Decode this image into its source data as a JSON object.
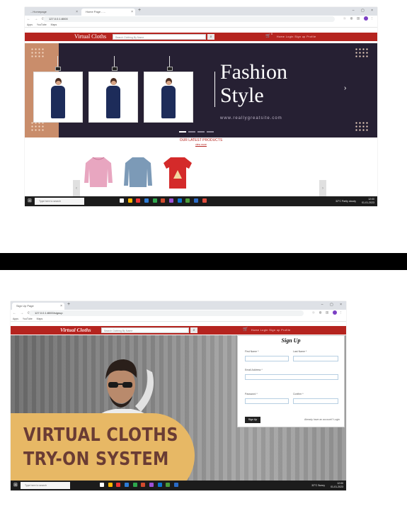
{
  "screenshot1": {
    "tabs": [
      {
        "label": "...Homepage",
        "active": false
      },
      {
        "label": "Home Page - ...",
        "active": true
      }
    ],
    "url": "127.0.0.1:8000",
    "bookmarks": [
      "Apps",
      "YouTube",
      "Maps"
    ],
    "site": {
      "brand": "Virtual Cloths",
      "search_placeholder": "Search Clothing By Name",
      "cart_count": "0",
      "nav_links": "Home  Login  Sign up  Profile"
    },
    "hero": {
      "title_line1": "Fashion",
      "title_line2": "Style",
      "website": "www.reallygreatsite.com",
      "next_arrow": "›"
    },
    "promo_heading": "OUR LATEST PRODUCTS",
    "promo_link": "view more"
  },
  "screenshot2": {
    "tabs": [
      {
        "label": "Sign Up Page",
        "active": true
      }
    ],
    "url": "127.0.0.1:8000/signup",
    "site": {
      "brand": "Virtual Cloths",
      "search_placeholder": "Search Clothing By Name",
      "nav_links": "Home  Login  Sign up  Profile"
    },
    "hero_text_line1": "VIRTUAL CLOTHS",
    "hero_text_line2": "TRY-ON SYSTEM",
    "signup": {
      "title": "Sign Up",
      "fields": [
        {
          "label": "First Name *"
        },
        {
          "label": "Last Name *"
        },
        {
          "label": "Email Address *"
        },
        {
          "label": "Password *"
        },
        {
          "label": "Confirm *"
        }
      ],
      "button": "Sign Up",
      "login_prompt": "Already have an account? Login"
    }
  },
  "taskbar": {
    "search": "Type here to search",
    "weather1": "32°C  Partly cloudy",
    "weather2": "32°C  Sunny",
    "clock_time": "12:00",
    "clock_date": "01-01-2023"
  }
}
